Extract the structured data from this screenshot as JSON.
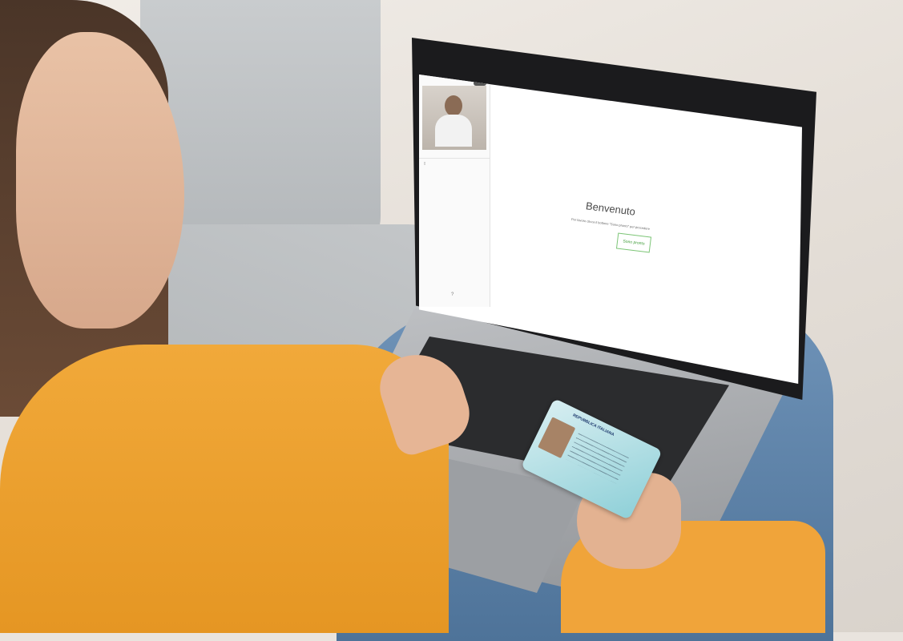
{
  "screen": {
    "sidebar": {
      "video_caption": "",
      "document_label": "",
      "footer_icon": "help-icon"
    },
    "toolbar_icons": [
      "flag-icon",
      "camera-icon",
      "fullscreen-icon"
    ],
    "main": {
      "title": "Benvenuto",
      "instructions": "Per favore clicca il bottone \"Sono pronto\" per procedere",
      "ready_button": "Sono pronto"
    }
  },
  "id_card": {
    "header": "REPUBBLICA ITALIANA"
  },
  "colors": {
    "accent_green": "#3b9a34",
    "sweater": "#f1a93a",
    "card": "#8fd0d8"
  }
}
